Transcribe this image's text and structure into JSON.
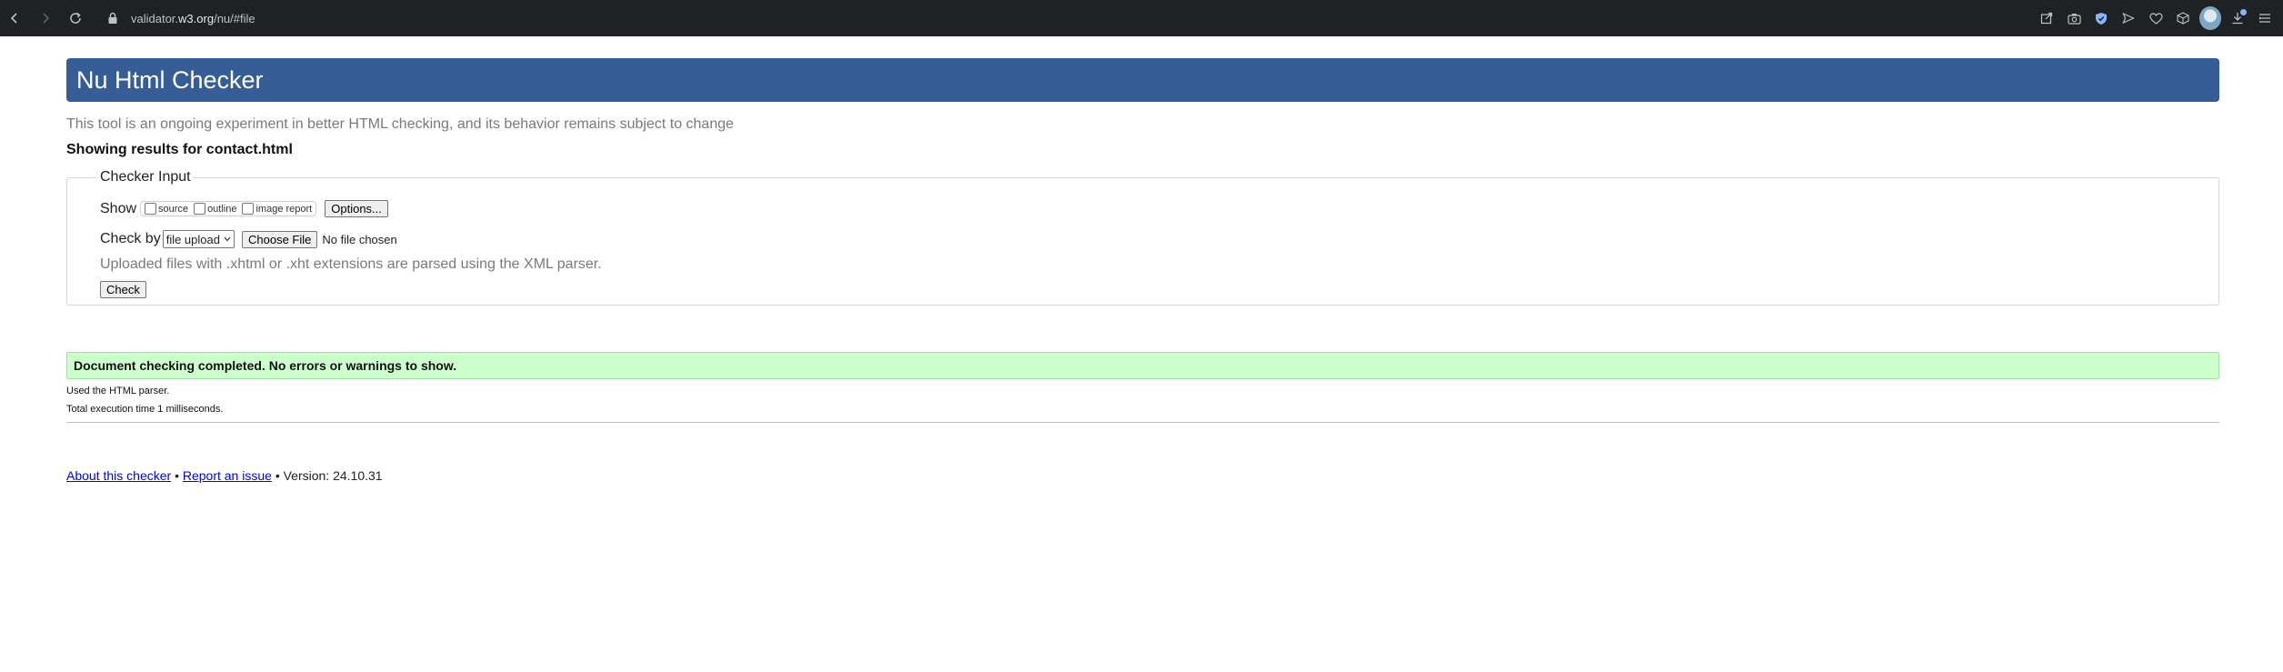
{
  "browser": {
    "url_prefix": "validator.",
    "url_domain": "w3.org",
    "url_path": "/nu/#file",
    "icons": [
      "back-icon",
      "forward-icon",
      "reload-icon",
      "lock-icon",
      "share-icon",
      "screenshot-icon",
      "shield-icon",
      "send-icon",
      "heart-icon",
      "cube-icon",
      "avatar",
      "download-icon",
      "menu-icon"
    ]
  },
  "header": {
    "title": "Nu Html Checker"
  },
  "intro": "This tool is an ongoing experiment in better HTML checking, and its behavior remains subject to change",
  "showing_results": "Showing results for contact.html",
  "checker": {
    "legend": "Checker Input",
    "show_label": "Show",
    "show_options": [
      {
        "label": "source",
        "checked": false
      },
      {
        "label": "outline",
        "checked": false
      },
      {
        "label": "image report",
        "checked": false
      }
    ],
    "options_button": "Options...",
    "check_by_label": "Check by",
    "check_by_value": "file upload",
    "choose_file_button": "Choose File",
    "no_file_text": "No file chosen",
    "xml_note": "Uploaded files with .xhtml or .xht extensions are parsed using the XML parser.",
    "check_button": "Check"
  },
  "results": {
    "success_message": "Document checking completed. No errors or warnings to show.",
    "parser_note": "Used the HTML parser.",
    "execution_time": "Total execution time 1 milliseconds."
  },
  "footer": {
    "about_link": "About this checker",
    "separator": "•",
    "report_link": "Report an issue",
    "version": "Version: 24.10.31"
  }
}
